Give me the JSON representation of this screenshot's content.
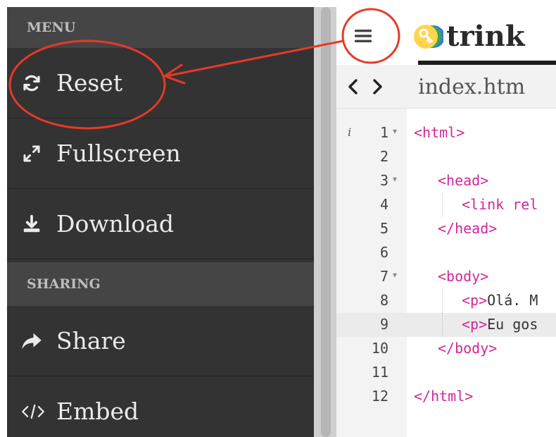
{
  "menu": {
    "sections": [
      {
        "header": "MENU",
        "items": [
          {
            "label": "Reset",
            "icon": "refresh-icon"
          },
          {
            "label": "Fullscreen",
            "icon": "expand-icon"
          },
          {
            "label": "Download",
            "icon": "download-icon"
          }
        ]
      },
      {
        "header": "SHARING",
        "items": [
          {
            "label": "Share",
            "icon": "share-arrow-icon"
          },
          {
            "label": "Embed",
            "icon": "code-icon"
          }
        ]
      }
    ]
  },
  "topbar": {
    "menu_icon": "hamburger-icon",
    "logo_text": "trink",
    "logo_icon": "key-logo-icon",
    "logo_colors": [
      "#3b78e7",
      "#34a853",
      "#fbbc05",
      "#ffd54f"
    ]
  },
  "tabbar": {
    "prev_icon": "chevron-left-icon",
    "next_icon": "chevron-right-icon",
    "file_tab": "index.htm"
  },
  "editor": {
    "info_marker": "i",
    "active_line": 9,
    "lines": [
      {
        "n": "1",
        "fold": true,
        "indent": 0,
        "segments": [
          {
            "t": "<html>",
            "c": "tag"
          }
        ]
      },
      {
        "n": "2",
        "fold": false,
        "indent": 0,
        "segments": []
      },
      {
        "n": "3",
        "fold": true,
        "indent": 1,
        "segments": [
          {
            "t": "<head>",
            "c": "tag"
          }
        ]
      },
      {
        "n": "4",
        "fold": false,
        "indent": 2,
        "segments": [
          {
            "t": "<link rel",
            "c": "tag"
          }
        ]
      },
      {
        "n": "5",
        "fold": false,
        "indent": 1,
        "segments": [
          {
            "t": "</head>",
            "c": "tag"
          }
        ]
      },
      {
        "n": "6",
        "fold": false,
        "indent": 0,
        "segments": []
      },
      {
        "n": "7",
        "fold": true,
        "indent": 1,
        "segments": [
          {
            "t": "<body>",
            "c": "tag"
          }
        ]
      },
      {
        "n": "8",
        "fold": false,
        "indent": 2,
        "segments": [
          {
            "t": "<p>",
            "c": "tag"
          },
          {
            "t": "Olá. M",
            "c": "txt"
          }
        ]
      },
      {
        "n": "9",
        "fold": false,
        "indent": 2,
        "segments": [
          {
            "t": "<p>",
            "c": "tag"
          },
          {
            "t": "Eu gos",
            "c": "txt"
          }
        ]
      },
      {
        "n": "10",
        "fold": false,
        "indent": 1,
        "segments": [
          {
            "t": "</body>",
            "c": "tag"
          }
        ]
      },
      {
        "n": "11",
        "fold": false,
        "indent": 0,
        "segments": []
      },
      {
        "n": "12",
        "fold": false,
        "indent": 0,
        "segments": [
          {
            "t": "</html>",
            "c": "tag"
          }
        ]
      }
    ]
  },
  "annotation": {
    "color": "#e53a26"
  }
}
